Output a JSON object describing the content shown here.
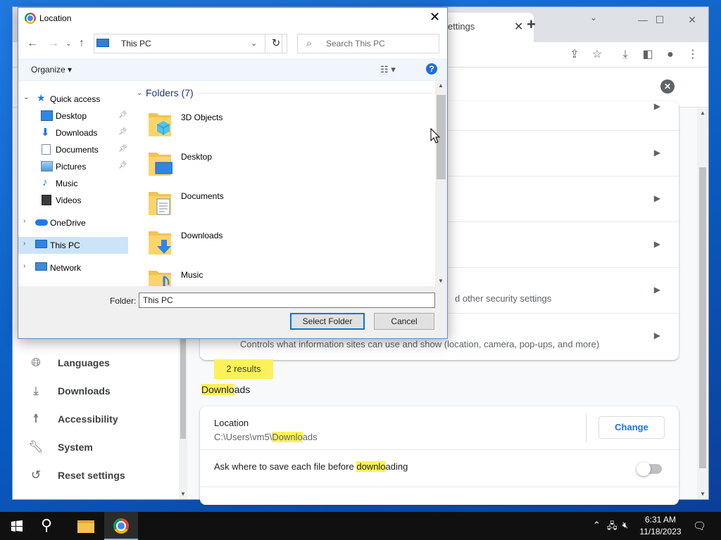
{
  "browser": {
    "tab_label": "ettings",
    "tab_close": "✕",
    "new_tab": "+",
    "minimize": "—",
    "maximize": "☐",
    "close": "✕",
    "search_clear": "✕"
  },
  "sidebar": {
    "items": [
      {
        "label": "Languages",
        "icon": "globe-icon"
      },
      {
        "label": "Downloads",
        "icon": "download-icon"
      },
      {
        "label": "Accessibility",
        "icon": "accessibility-icon"
      },
      {
        "label": "System",
        "icon": "wrench-icon"
      },
      {
        "label": "Reset settings",
        "icon": "history-icon"
      }
    ]
  },
  "settings_rows": {
    "security_partial": "d other security settings",
    "site_settings_sub": "Controls what information sites can use and show (location, camera, pop-ups, and more)"
  },
  "search_results": {
    "badge": "2 results",
    "section_title_hl": "Downlo",
    "section_title_rest": "ads"
  },
  "downloads": {
    "location_label": "Location",
    "path_prefix": "C:\\Users\\vm5\\",
    "path_hl": "Downlo",
    "path_rest": "ads",
    "change_button": "Change",
    "ask_prefix": "Ask where to save each file before ",
    "ask_hl": "downlo",
    "ask_rest": "ading",
    "ask_enabled": false
  },
  "dialog": {
    "title": "Location",
    "close": "✕",
    "address": "This PC",
    "search_placeholder": "Search This PC",
    "organize": "Organize ▾",
    "help": "?",
    "folders_heading": "Folders (7)",
    "nav": [
      {
        "label": "Quick access",
        "arrow": "⌄",
        "pinned": false
      },
      {
        "label": "Desktop",
        "pinned": true
      },
      {
        "label": "Downloads",
        "pinned": true
      },
      {
        "label": "Documents",
        "pinned": true
      },
      {
        "label": "Pictures",
        "pinned": true
      },
      {
        "label": "Music",
        "pinned": false
      },
      {
        "label": "Videos",
        "pinned": false
      },
      {
        "label": "OneDrive",
        "arrow": "›",
        "pinned": false
      },
      {
        "label": "This PC",
        "arrow": "›",
        "pinned": false,
        "selected": true
      },
      {
        "label": "Network",
        "arrow": "›",
        "pinned": false
      }
    ],
    "folders": [
      "3D Objects",
      "Desktop",
      "Documents",
      "Downloads",
      "Music"
    ],
    "folder_label": "Folder:",
    "folder_value": "This PC",
    "select_button": "Select Folder",
    "cancel_button": "Cancel"
  },
  "taskbar": {
    "time": "6:31 AM",
    "date": "11/18/2023"
  },
  "colors": {
    "highlight": "#fdf15a",
    "accent": "#1a73e8",
    "selection": "#cce4f7"
  }
}
